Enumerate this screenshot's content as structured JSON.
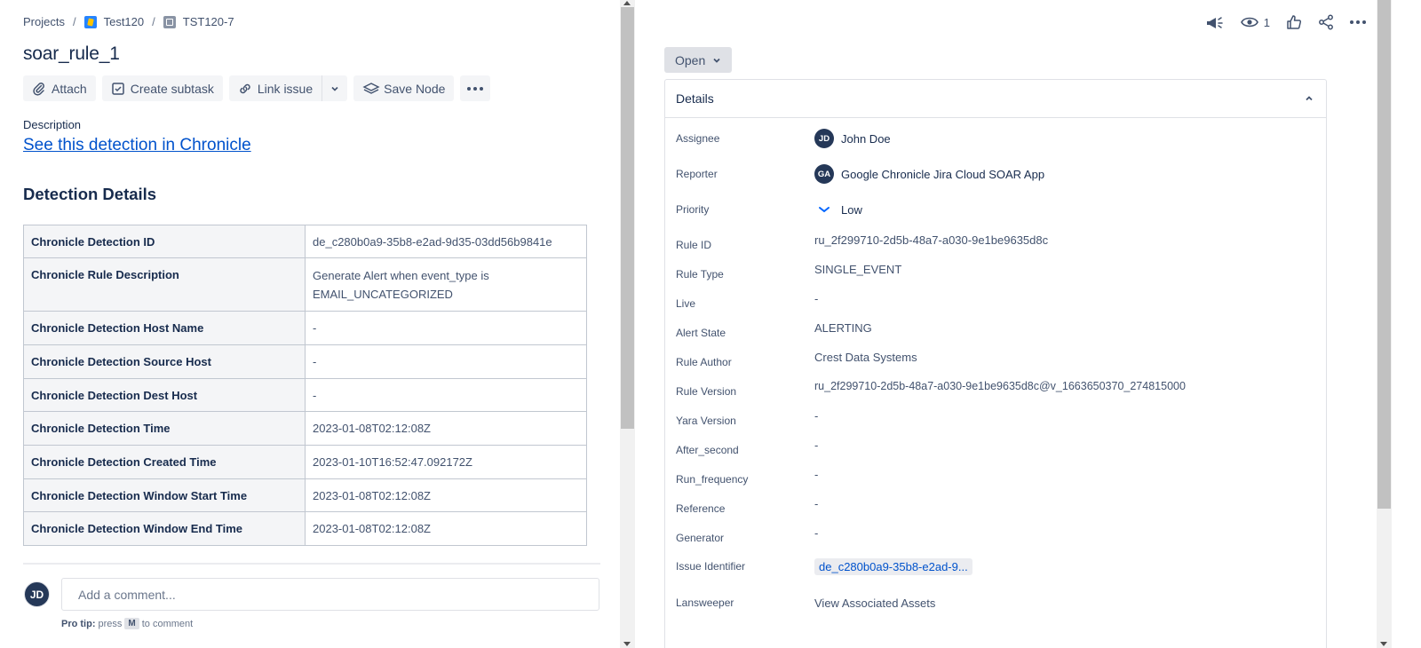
{
  "breadcrumb": {
    "projects": "Projects",
    "project": "Test120",
    "issue_key": "TST120-7",
    "separator": "/"
  },
  "issue": {
    "title": "soar_rule_1",
    "status": "Open"
  },
  "toolbar": {
    "attach": "Attach",
    "create_subtask": "Create subtask",
    "link_issue": "Link issue",
    "save_node": "Save Node"
  },
  "description": {
    "label": "Description",
    "link_text": "See this detection in Chronicle"
  },
  "detection_details": {
    "title": "Detection Details",
    "rows": [
      {
        "key": "Chronicle Detection ID",
        "value": "de_c280b0a9-35b8-e2ad-9d35-03dd56b9841e"
      },
      {
        "key": "Chronicle Rule Description",
        "value": "Generate Alert when event_type is EMAIL_UNCATEGORIZED"
      },
      {
        "key": "Chronicle Detection Host Name",
        "value": "-"
      },
      {
        "key": "Chronicle Detection Source Host",
        "value": "-"
      },
      {
        "key": "Chronicle Detection Dest Host",
        "value": "-"
      },
      {
        "key": "Chronicle Detection Time",
        "value": "2023-01-08T02:12:08Z"
      },
      {
        "key": "Chronicle Detection Created Time",
        "value": "2023-01-10T16:52:47.092172Z"
      },
      {
        "key": "Chronicle Detection Window Start Time",
        "value": "2023-01-08T02:12:08Z"
      },
      {
        "key": "Chronicle Detection Window End Time",
        "value": "2023-01-08T02:12:08Z"
      }
    ]
  },
  "comment": {
    "avatar_initials": "JD",
    "placeholder": "Add a comment...",
    "protip_label": "Pro tip:",
    "protip_press": "press",
    "protip_key": "M",
    "protip_suffix": "to comment"
  },
  "top_actions": {
    "watchers_count": "1"
  },
  "details_panel": {
    "title": "Details",
    "fields": [
      {
        "label": "Assignee",
        "value": "John Doe",
        "avatar": "JD"
      },
      {
        "label": "Reporter",
        "value": "Google Chronicle Jira Cloud SOAR App",
        "avatar": "GA"
      },
      {
        "label": "Priority",
        "value": "Low"
      },
      {
        "label": "Rule ID",
        "value": "ru_2f299710-2d5b-48a7-a030-9e1be9635d8c"
      },
      {
        "label": "Rule Type",
        "value": "SINGLE_EVENT"
      },
      {
        "label": "Live",
        "value": "-"
      },
      {
        "label": "Alert State",
        "value": "ALERTING"
      },
      {
        "label": "Rule Author",
        "value": "Crest Data Systems"
      },
      {
        "label": "Rule Version",
        "value": "ru_2f299710-2d5b-48a7-a030-9e1be9635d8c@v_1663650370_274815000"
      },
      {
        "label": "Yara Version",
        "value": "-"
      },
      {
        "label": "After_second",
        "value": "-"
      },
      {
        "label": "Run_frequency",
        "value": "-"
      },
      {
        "label": "Reference",
        "value": "-"
      },
      {
        "label": "Generator",
        "value": "-"
      },
      {
        "label": "Issue Identifier",
        "value": "de_c280b0a9-35b8-e2ad-9..."
      },
      {
        "label": "Lansweeper",
        "value": "View Associated Assets"
      }
    ]
  },
  "colors": {
    "link": "#0052cc",
    "text": "#172b4d",
    "subtle_text": "#42526e",
    "button_bg": "#f4f5f7",
    "border": "#dfe1e6",
    "avatar_bg": "#253858",
    "priority_low": "#0065ff"
  }
}
